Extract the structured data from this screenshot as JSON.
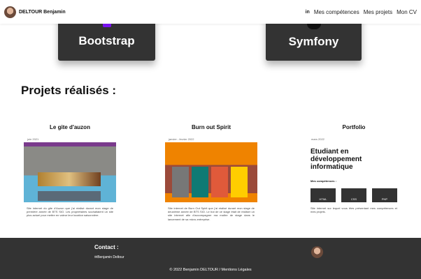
{
  "nav": {
    "brand": "DELTOUR Benjamin",
    "linkedin": "in",
    "links": [
      "Mes compétences",
      "Mes projets",
      "Mon CV"
    ]
  },
  "skills": [
    "Bootstrap",
    "Symfony"
  ],
  "projects_title": "Projets réalisés :",
  "projects": [
    {
      "title": "Le gite d'auzon",
      "date": "juin 2021",
      "desc": "Site internet du gite d'Auzon que j'ai réalisé durant mon stage de première année de BTS SIO. Les propriétaires souhaitaient un site plus actuel pour mettre en valeur leur location saisonnière."
    },
    {
      "title": "Burn out Spirit",
      "date": "janvier - fevrier 2022",
      "desc": "Site internet de Burn Out Spirit que j'ai réalisé durant mon stage de deuxième année de BTS SIO. Le but de ce stage était de réaliser un site internet afin d'accompagner ma maître de stage dans le lancement de sa micro-entreprise."
    },
    {
      "title": "Portfolio",
      "date": "mars 2022",
      "desc": "Site internet sur lequel vous êtes présentant mes compétences et mes projets.",
      "thumb_heading": "Etudiant en développement informatique",
      "thumb_sub": "Mes compétences :",
      "thumb_cards": [
        "HTML",
        "CSS",
        "PHP"
      ]
    }
  ],
  "footer": {
    "contact_title": "Contact :",
    "contact_name": "✉Benjamin Deltour",
    "copyright": "© 2022 Benjamin DELTOUR / Mentions Légales"
  }
}
